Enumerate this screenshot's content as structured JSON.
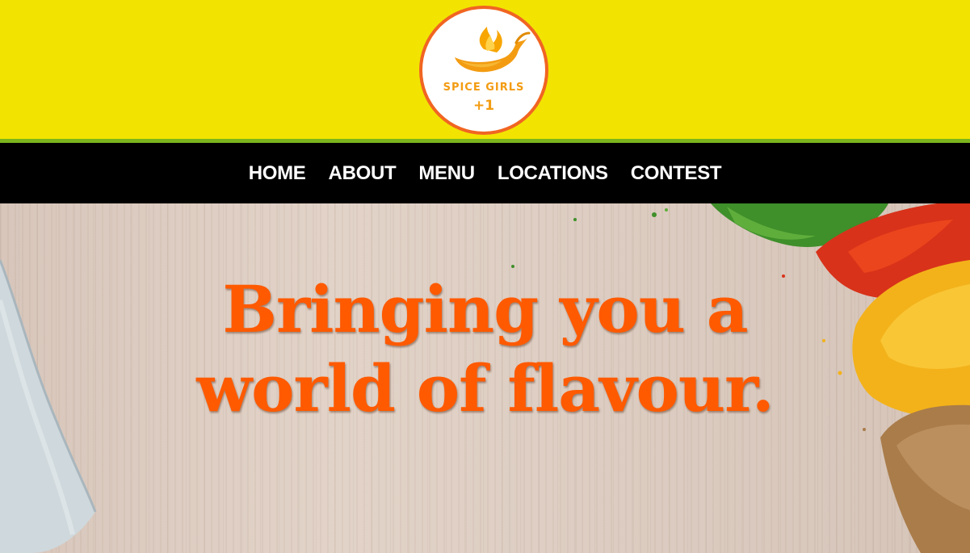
{
  "brand": {
    "name": "SPICE GIRLS",
    "sub": "+1",
    "logo_icon": "chili-pepper-flame-icon"
  },
  "nav": {
    "items": [
      {
        "label": "HOME"
      },
      {
        "label": "ABOUT"
      },
      {
        "label": "MENU"
      },
      {
        "label": "LOCATIONS"
      },
      {
        "label": "CONTEST"
      }
    ]
  },
  "hero": {
    "line1": "Bringing you a",
    "line2": "world of flavour."
  },
  "colors": {
    "header_bg": "#f2e400",
    "accent_green": "#7ab51d",
    "nav_bg": "#000000",
    "headline": "#ff5a00",
    "logo_ring": "#f16522",
    "logo_text": "#f39c12"
  }
}
